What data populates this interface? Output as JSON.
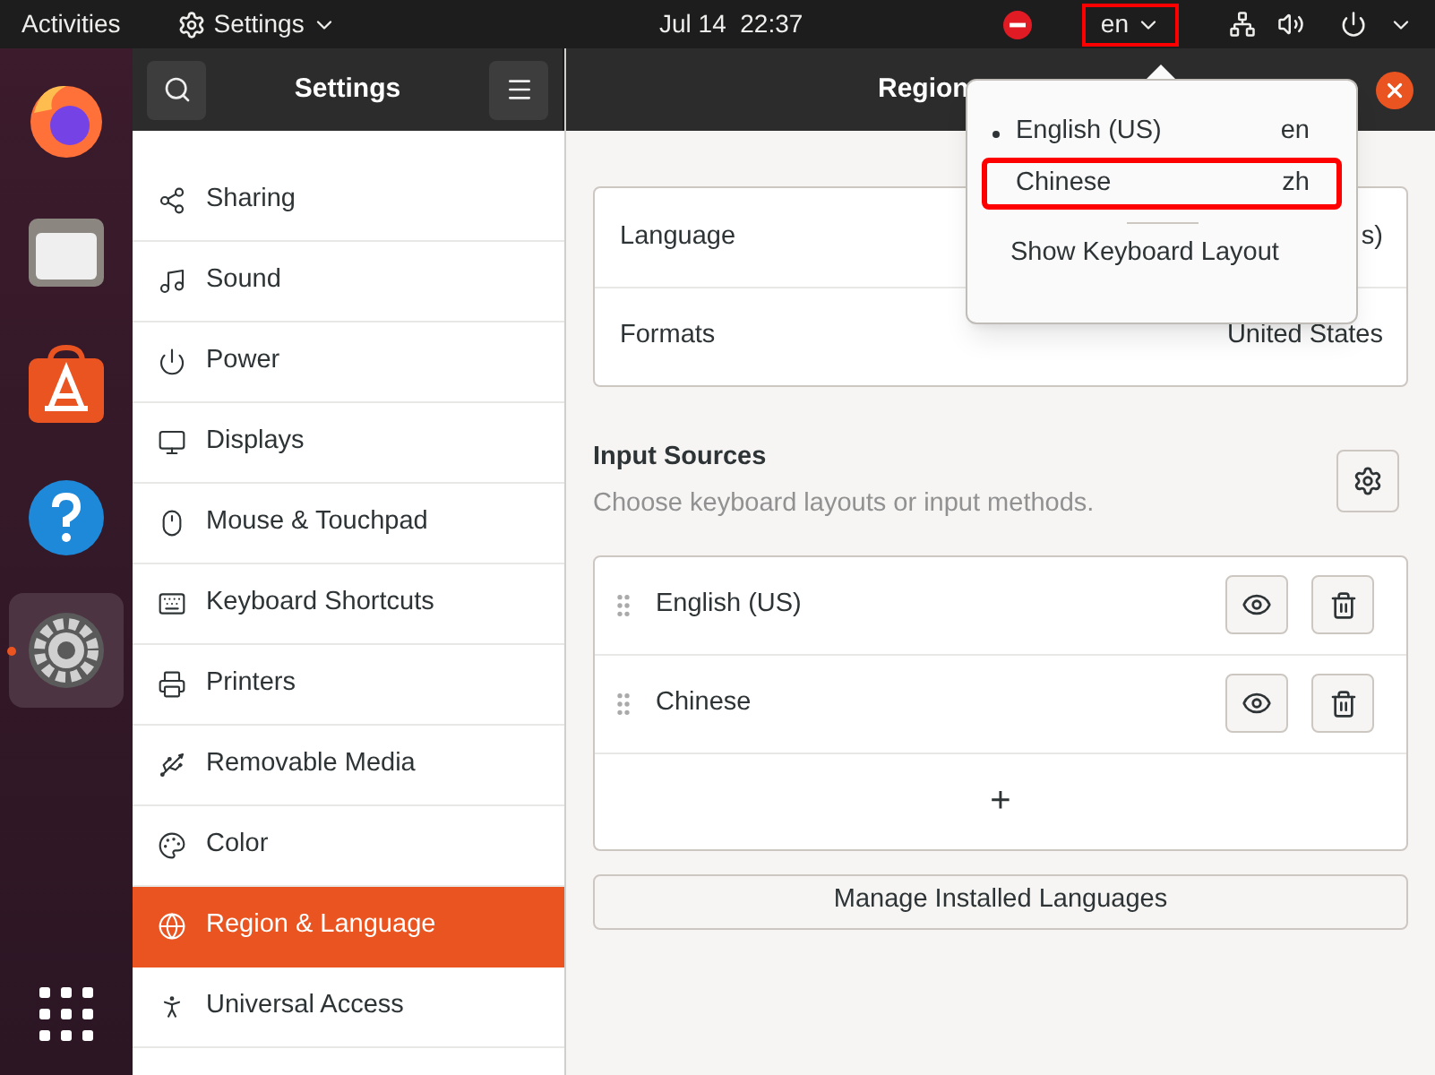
{
  "top_bar": {
    "activities": "Activities",
    "app_menu": "Settings",
    "clock": "Jul 14  22:37",
    "input_indicator": {
      "label": "en",
      "highlighted": true
    }
  },
  "dock": {
    "apps": [
      {
        "kind": "firefox",
        "active": false
      },
      {
        "kind": "files",
        "active": false
      },
      {
        "kind": "software",
        "active": false
      },
      {
        "kind": "help",
        "active": false
      },
      {
        "kind": "settings",
        "active": true
      }
    ]
  },
  "sidebar": {
    "title": "Settings",
    "items": [
      {
        "label": "Sharing",
        "selected": false
      },
      {
        "label": "Sound",
        "selected": false
      },
      {
        "label": "Power",
        "selected": false
      },
      {
        "label": "Displays",
        "selected": false
      },
      {
        "label": "Mouse & Touchpad",
        "selected": false
      },
      {
        "label": "Keyboard Shortcuts",
        "selected": false
      },
      {
        "label": "Printers",
        "selected": false
      },
      {
        "label": "Removable Media",
        "selected": false
      },
      {
        "label": "Color",
        "selected": false
      },
      {
        "label": "Region & Language",
        "selected": true
      },
      {
        "label": "Universal Access",
        "selected": false
      }
    ]
  },
  "main": {
    "title": "Region",
    "settings": [
      {
        "label": "Language",
        "value": "s)"
      },
      {
        "label": "Formats",
        "value": "United States"
      }
    ],
    "input_sources": {
      "heading": "Input Sources",
      "subtitle": "Choose keyboard layouts or input methods.",
      "sources": [
        {
          "name": "English (US)"
        },
        {
          "name": "Chinese"
        }
      ],
      "add": "+"
    },
    "manage_button": "Manage Installed Languages"
  },
  "input_menu": {
    "items": [
      {
        "label": "English (US)",
        "code": "en",
        "selected": true,
        "highlighted": false
      },
      {
        "label": "Chinese",
        "code": "zh",
        "selected": false,
        "highlighted": true
      }
    ],
    "show_layout": "Show Keyboard Layout"
  }
}
